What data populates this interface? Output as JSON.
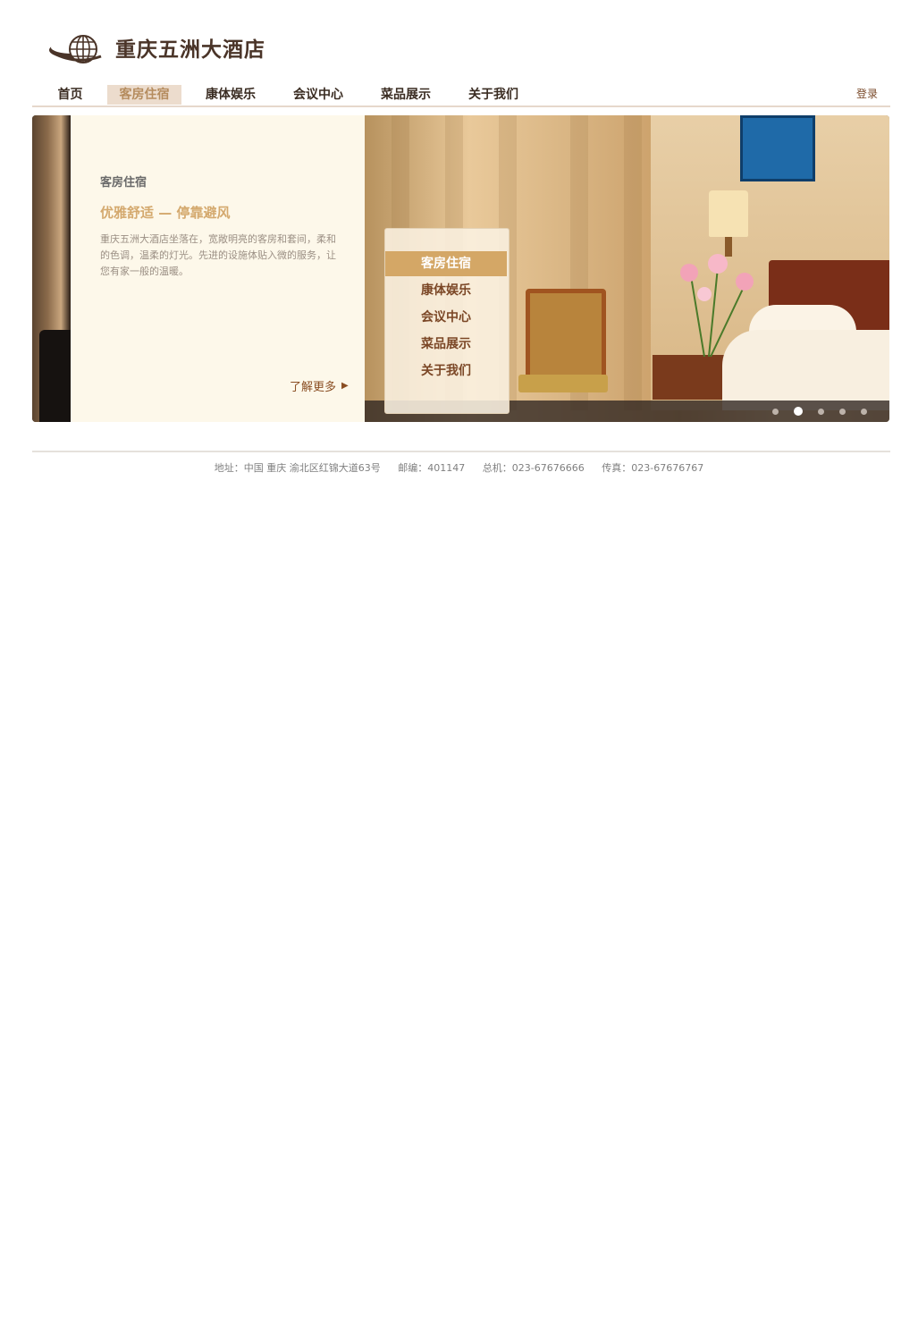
{
  "brand": {
    "name": "重庆五洲大酒店",
    "logo_icon": "globe-icon"
  },
  "nav": {
    "items": [
      {
        "label": "首页",
        "active": false
      },
      {
        "label": "客房住宿",
        "active": true
      },
      {
        "label": "康体娱乐",
        "active": false
      },
      {
        "label": "会议中心",
        "active": false
      },
      {
        "label": "菜品展示",
        "active": false
      },
      {
        "label": "关于我们",
        "active": false
      }
    ],
    "login_label": "登录"
  },
  "banner": {
    "title": "客房住宿",
    "subtitle": "优雅舒适 — 停靠避风",
    "description": "重庆五洲大酒店坐落在，宽敞明亮的客房和套间，柔和的色调，温柔的灯光。先进的设施体贴入微的服务，让您有家一般的温暖。",
    "learn_more": "了解更多",
    "menu": [
      {
        "label": "客房住宿",
        "active": true
      },
      {
        "label": "康体娱乐",
        "active": false
      },
      {
        "label": "会议中心",
        "active": false
      },
      {
        "label": "菜品展示",
        "active": false
      },
      {
        "label": "关于我们",
        "active": false
      }
    ],
    "slides": {
      "count": 5,
      "active_index": 1
    }
  },
  "footer": {
    "address": "地址：中国 重庆 渝北区红锦大道63号",
    "postcode": "邮编：401147",
    "phone": "总机：023-67676666",
    "fax": "传真：023-67676767"
  },
  "colors": {
    "brand_dark": "#4a3428",
    "accent": "#d4a766",
    "nav_active_bg": "#ecdccd",
    "panel_bg": "#fdf8ea"
  }
}
